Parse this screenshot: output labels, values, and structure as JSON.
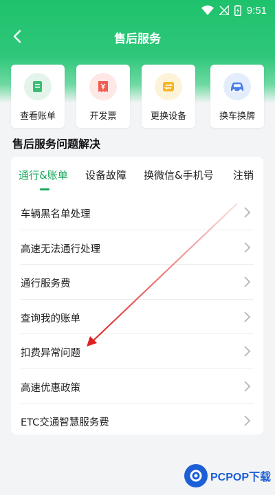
{
  "status": {
    "time": "9:51"
  },
  "nav": {
    "title": "售后服务"
  },
  "quick_actions": [
    {
      "label": "查看账单",
      "icon": "bill-scroll-icon",
      "bg": "#e3f5ea",
      "fg": "#3bbd74"
    },
    {
      "label": "开发票",
      "icon": "invoice-icon",
      "bg": "#fde8e6",
      "fg": "#ef5e52"
    },
    {
      "label": "更换设备",
      "icon": "swap-device-icon",
      "bg": "#fdf3d9",
      "fg": "#f6b624"
    },
    {
      "label": "换车换牌",
      "icon": "car-icon",
      "bg": "#e4edfc",
      "fg": "#4a7ee8"
    }
  ],
  "section": {
    "title": "售后服务问题解决"
  },
  "tabs": [
    {
      "label": "通行&账单",
      "active": true
    },
    {
      "label": "设备故障",
      "active": false
    },
    {
      "label": "换微信&手机号",
      "active": false
    },
    {
      "label": "注销",
      "active": false
    }
  ],
  "items": [
    {
      "label": "车辆黑名单处理"
    },
    {
      "label": "高速无法通行处理"
    },
    {
      "label": "通行服务费"
    },
    {
      "label": "查询我的账单"
    },
    {
      "label": "扣费异常问题"
    },
    {
      "label": "高速优惠政策"
    },
    {
      "label": "ETC交通智慧服务费"
    }
  ],
  "watermark": {
    "brand": "PCPOP下载"
  },
  "colors": {
    "primary": "#1ec26c",
    "accent": "#1aaa5e",
    "annotation": "#e02020"
  }
}
